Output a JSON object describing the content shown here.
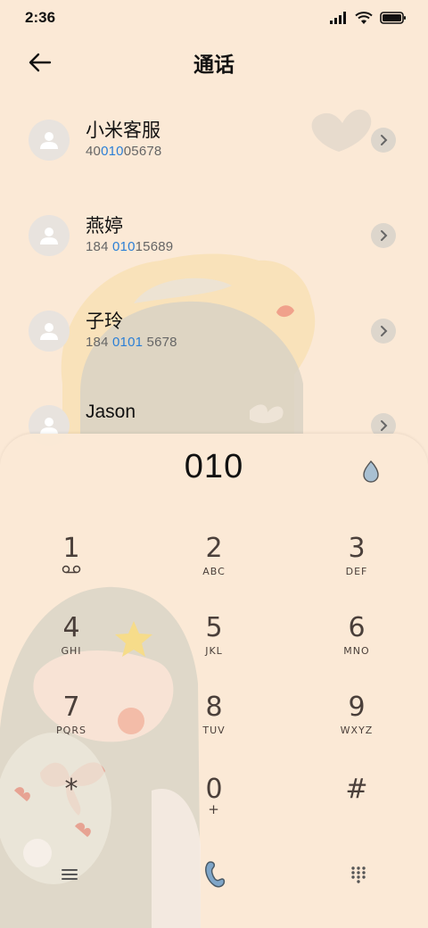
{
  "status_bar": {
    "time": "2:36",
    "icons": [
      "signal-icon",
      "wifi-icon",
      "battery-icon"
    ]
  },
  "header": {
    "title": "通话",
    "back_icon": "arrow-left-icon"
  },
  "contacts": [
    {
      "name": "小米客服",
      "number_pre": "40",
      "number_hl": "010",
      "number_post": "05678"
    },
    {
      "name": "燕婷",
      "number_pre": "184 ",
      "number_hl": "010",
      "number_post": "15689"
    },
    {
      "name": "子玲",
      "number_pre": "184 ",
      "number_hl": "0101",
      "number_post": " 5678"
    },
    {
      "name": "Jason",
      "number_pre": "",
      "number_hl": "",
      "number_post": ""
    }
  ],
  "dialpad": {
    "input_value": "010",
    "action_icon": "water-drop-icon",
    "keys": [
      {
        "digit": "1",
        "letters": "voicemail"
      },
      {
        "digit": "2",
        "letters": "ABC"
      },
      {
        "digit": "3",
        "letters": "DEF"
      },
      {
        "digit": "4",
        "letters": "GHI"
      },
      {
        "digit": "5",
        "letters": "JKL"
      },
      {
        "digit": "6",
        "letters": "MNO"
      },
      {
        "digit": "7",
        "letters": "PQRS"
      },
      {
        "digit": "8",
        "letters": "TUV"
      },
      {
        "digit": "9",
        "letters": "WXYZ"
      },
      {
        "digit": "*",
        "letters": ""
      },
      {
        "digit": "0",
        "letters": "+"
      },
      {
        "digit": "#",
        "letters": ""
      }
    ],
    "bottom_icons": [
      "menu-icon",
      "phone-call-icon",
      "dialpad-grid-icon"
    ]
  },
  "colors": {
    "background": "#fbe9d6",
    "highlight": "#2b7fd6",
    "key_text": "#4a3f3a",
    "call_button": "#7fa6c9"
  }
}
